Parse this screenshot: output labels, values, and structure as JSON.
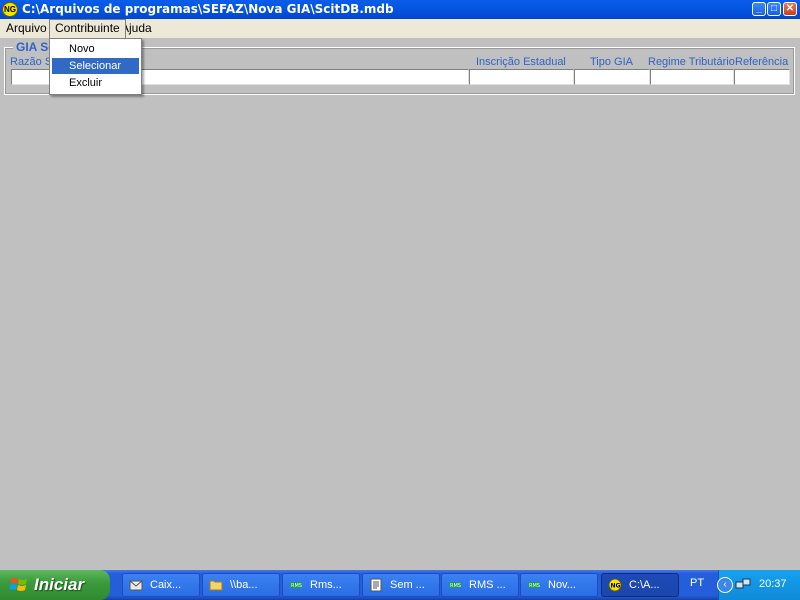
{
  "window": {
    "icon_text": "NG",
    "title": "C:\\Arquivos de programas\\SEFAZ\\Nova GIA\\ScitDB.mdb"
  },
  "menubar": {
    "items": [
      "Arquivo",
      "Contribuinte",
      "Ajuda"
    ]
  },
  "dropdown": {
    "items": [
      "Novo",
      "Selecionar",
      "Excluir"
    ],
    "selected": "Selecionar"
  },
  "group": {
    "title": "GIA Se",
    "columns": [
      "Razão S",
      "Inscrição Estadual",
      "Tipo GIA",
      "Regime Tributário",
      "Referência"
    ]
  },
  "taskbar": {
    "start_label": "Iniciar",
    "buttons": [
      "Caix...",
      "\\\\ba...",
      "Rms...",
      "Sem ...",
      "RMS ...",
      "Nov...",
      "C:\\A..."
    ],
    "language": "PT",
    "clock": "20:37"
  },
  "colors": {
    "title_bar": "#0454e0",
    "menu_bar": "#ece9d8",
    "workspace": "#c0c0c0",
    "label_blue": "#2e63c8",
    "menu_highlight": "#316ac5",
    "taskbar": "#245edb",
    "start_button": "#3c9c3c"
  }
}
